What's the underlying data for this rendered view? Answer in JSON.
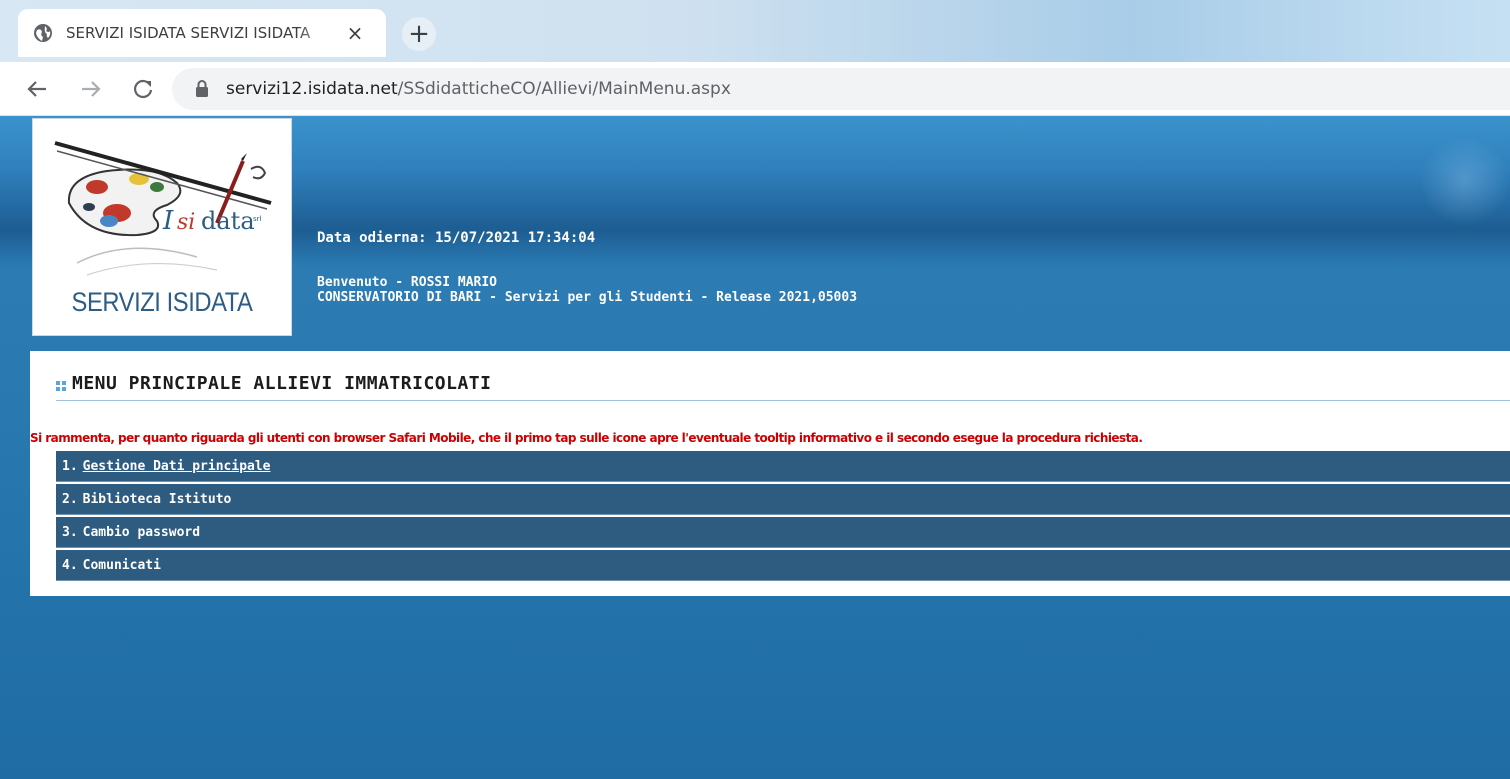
{
  "browser": {
    "tab_title": "SERVIZI ISIDATA SERVIZI ISIDATA",
    "tab_close": "×",
    "new_tab": "+",
    "url_host": "servizi12.isidata.net",
    "url_path": "/SSdidatticheCO/Allievi/MainMenu.aspx",
    "icons": [
      "globe-icon",
      "close-icon",
      "plus-icon",
      "back-arrow-icon",
      "forward-arrow-icon",
      "reload-icon",
      "lock-icon"
    ]
  },
  "header": {
    "logo_caption": "SERVIZI ISIDATA",
    "logo_wordmark": "Isidata srl",
    "date_line": "Data odierna: 15/07/2021 17:34:04",
    "welcome_line": "Benvenuto - ROSSI MARIO",
    "institution_line": "CONSERVATORIO DI BARI - Servizi per gli Studenti - Release 2021,05003"
  },
  "main": {
    "title": "MENU PRINCIPALE ALLIEVI IMMATRICOLATI",
    "notice": "Si rammenta, per quanto riguarda gli utenti con browser Safari Mobile, che il primo tap sulle icone apre l'eventuale tooltip informativo e il secondo esegue la procedura richiesta.",
    "menu_items": [
      {
        "num": "1.",
        "label": "Gestione Dati principale",
        "link": true
      },
      {
        "num": "2.",
        "label": "Biblioteca Istituto",
        "link": false
      },
      {
        "num": "3.",
        "label": "Cambio password",
        "link": false
      },
      {
        "num": "4.",
        "label": "Comunicati",
        "link": false
      }
    ]
  },
  "colors": {
    "page_blue": "#2a79b0",
    "menu_bar": "#2e5b80",
    "notice_red": "#cc0000",
    "logo_text": "#2c5d86"
  }
}
